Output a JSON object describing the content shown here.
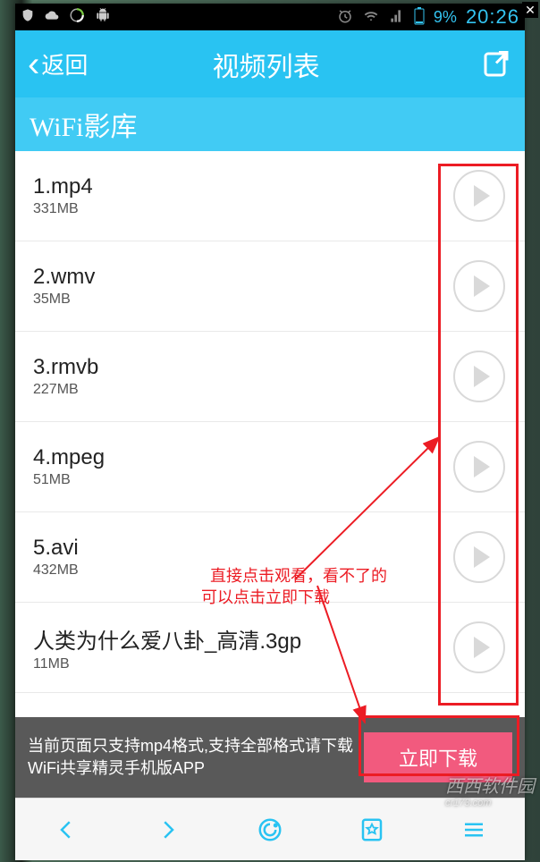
{
  "outer": {
    "close_glyph": "✕"
  },
  "statusbar": {
    "battery": "9%",
    "time": "20:26"
  },
  "titlebar": {
    "back_label": "返回",
    "title": "视频列表"
  },
  "section": {
    "title": "WiFi影库"
  },
  "files": [
    {
      "name": "1.mp4",
      "size": "331MB"
    },
    {
      "name": "2.wmv",
      "size": "35MB"
    },
    {
      "name": "3.rmvb",
      "size": "227MB"
    },
    {
      "name": "4.mpeg",
      "size": "51MB"
    },
    {
      "name": "5.avi",
      "size": "432MB"
    },
    {
      "name": "人类为什么爱八卦_高清.3gp",
      "size": "11MB"
    }
  ],
  "dlbar": {
    "message": "当前页面只支持mp4格式,支持全部格式请下载WiFi共享精灵手机版APP",
    "button": "立即下载"
  },
  "annotation": {
    "line1": "直接点击观看，看不了的",
    "line2": "可以点击立即下载"
  },
  "watermark": {
    "brand": "西西软件园",
    "url": "cr173.com"
  }
}
